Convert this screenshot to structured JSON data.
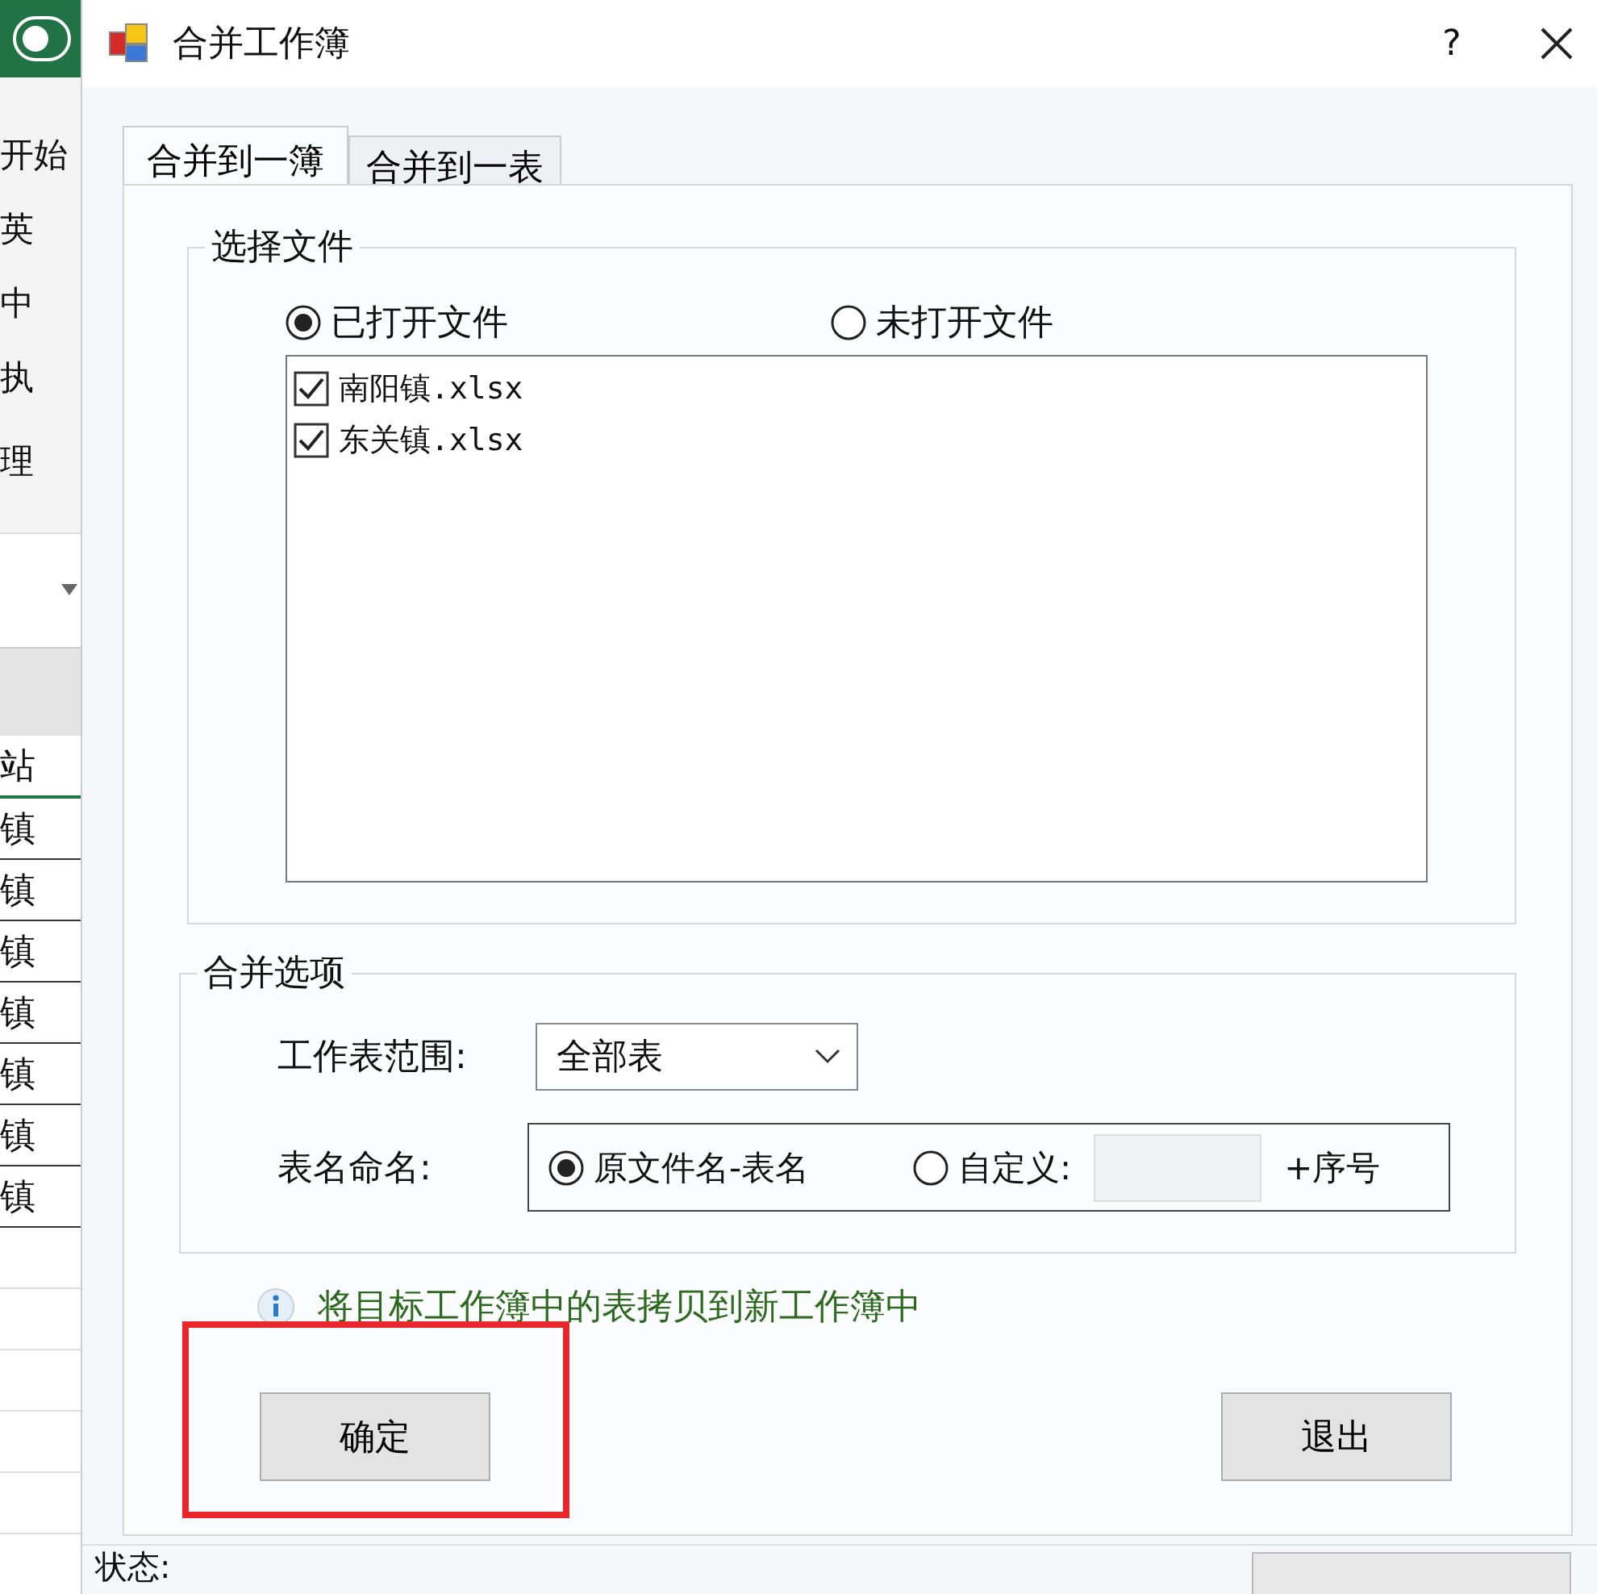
{
  "background_app": {
    "ribbon_tab": "开始",
    "ribbon_items": [
      "英",
      "中",
      "执"
    ],
    "group_label": "理",
    "cells": [
      "站",
      "镇",
      "镇",
      "镇",
      "镇",
      "镇",
      "镇",
      "镇"
    ]
  },
  "window": {
    "title": "合并工作簿",
    "help": "?"
  },
  "tabs": [
    {
      "label": "合并到一簿",
      "selected": true
    },
    {
      "label": "合并到一表",
      "selected": false
    }
  ],
  "file_group": {
    "title": "选择文件",
    "sources": [
      {
        "label": "已打开文件",
        "selected": true
      },
      {
        "label": "未打开文件",
        "selected": false
      }
    ],
    "files": [
      {
        "name": "南阳镇.xlsx",
        "checked": true
      },
      {
        "name": "东关镇.xlsx",
        "checked": true
      }
    ]
  },
  "options_group": {
    "title": "合并选项",
    "sheet_range": {
      "label": "工作表范围:",
      "value": "全部表"
    },
    "sheet_naming": {
      "label": "表名命名:",
      "options": [
        {
          "label": "原文件名-表名",
          "selected": true
        },
        {
          "label": "自定义:",
          "selected": false
        }
      ],
      "suffix": "+序号"
    }
  },
  "hint": "将目标工作簿中的表拷贝到新工作簿中",
  "buttons": [
    {
      "label": "确定",
      "highlighted": true
    },
    {
      "label": "退出",
      "highlighted": false
    }
  ],
  "status_bar": {
    "label": "状态:"
  }
}
